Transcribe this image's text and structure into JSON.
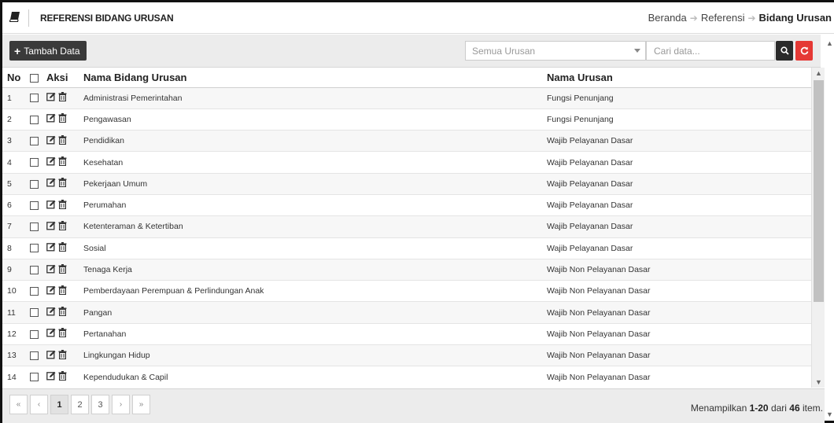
{
  "header": {
    "title": "REFERENSI BIDANG URUSAN",
    "breadcrumb": [
      "Beranda",
      "Referensi",
      "Bidang Urusan"
    ]
  },
  "toolbar": {
    "add_label": "Tambah Data",
    "urusan_select_value": "Semua Urusan",
    "search_placeholder": "Cari data..."
  },
  "table": {
    "columns": [
      "No",
      "",
      "Aksi",
      "Nama Bidang Urusan",
      "Nama Urusan"
    ],
    "rows": [
      {
        "no": "1",
        "nama": "Administrasi Pemerintahan",
        "urusan": "Fungsi Penunjang"
      },
      {
        "no": "2",
        "nama": "Pengawasan",
        "urusan": "Fungsi Penunjang"
      },
      {
        "no": "3",
        "nama": "Pendidikan",
        "urusan": "Wajib Pelayanan Dasar"
      },
      {
        "no": "4",
        "nama": "Kesehatan",
        "urusan": "Wajib Pelayanan Dasar"
      },
      {
        "no": "5",
        "nama": "Pekerjaan Umum",
        "urusan": "Wajib Pelayanan Dasar"
      },
      {
        "no": "6",
        "nama": "Perumahan",
        "urusan": "Wajib Pelayanan Dasar"
      },
      {
        "no": "7",
        "nama": "Ketenteraman & Ketertiban",
        "urusan": "Wajib Pelayanan Dasar"
      },
      {
        "no": "8",
        "nama": "Sosial",
        "urusan": "Wajib Pelayanan Dasar"
      },
      {
        "no": "9",
        "nama": "Tenaga Kerja",
        "urusan": "Wajib Non Pelayanan Dasar"
      },
      {
        "no": "10",
        "nama": "Pemberdayaan Perempuan & Perlindungan Anak",
        "urusan": "Wajib Non Pelayanan Dasar"
      },
      {
        "no": "11",
        "nama": "Pangan",
        "urusan": "Wajib Non Pelayanan Dasar"
      },
      {
        "no": "12",
        "nama": "Pertanahan",
        "urusan": "Wajib Non Pelayanan Dasar"
      },
      {
        "no": "13",
        "nama": "Lingkungan Hidup",
        "urusan": "Wajib Non Pelayanan Dasar"
      },
      {
        "no": "14",
        "nama": "Kependudukan & Capil",
        "urusan": "Wajib Non Pelayanan Dasar"
      }
    ]
  },
  "pagination": {
    "first": "«",
    "prev": "‹",
    "pages": [
      "1",
      "2",
      "3"
    ],
    "active_page": "1",
    "next": "›",
    "last": "»"
  },
  "summary": {
    "prefix": "Menampilkan ",
    "range": "1-20",
    "middle": " dari ",
    "total": "46",
    "suffix": " item."
  },
  "colors": {
    "accent_dark": "#3a3a3a",
    "refresh_red": "#e53935",
    "toolbar_bg": "#ececec"
  },
  "icons": {
    "header": "book-icon",
    "add": "plus-icon",
    "search": "search-icon",
    "refresh": "refresh-icon",
    "edit": "edit-icon",
    "delete": "trash-icon"
  }
}
